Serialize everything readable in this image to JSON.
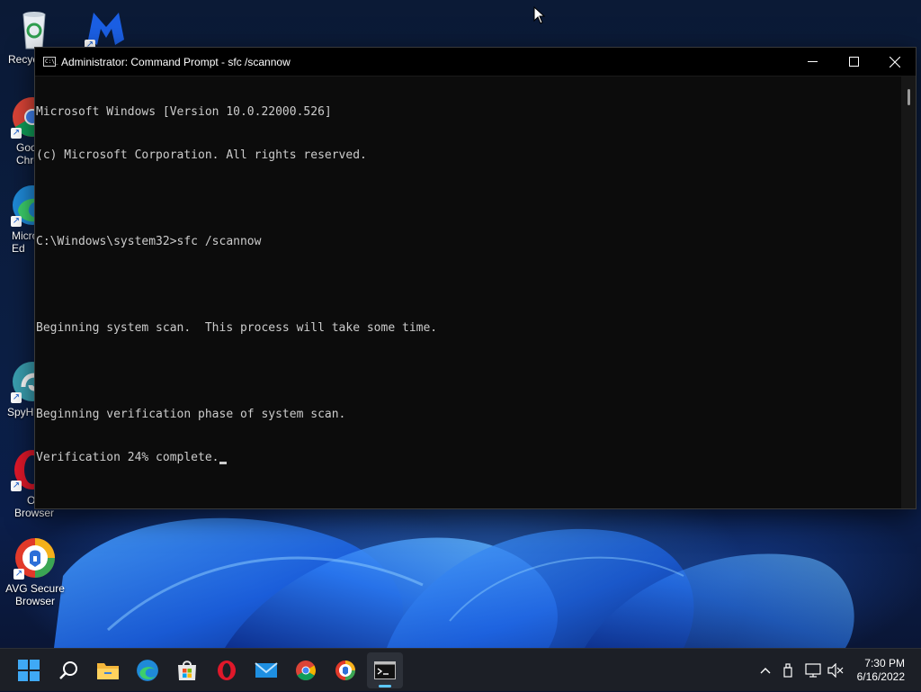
{
  "desktop": {
    "icons": [
      {
        "name": "recycle-bin",
        "label": "Recyc"
      },
      {
        "name": "malwarebytes",
        "label": ""
      },
      {
        "name": "google-chrome",
        "label": "Goo\nChro"
      },
      {
        "name": "microsoft-edge",
        "label": "Micro\nEd"
      },
      {
        "name": "spyhunter",
        "label": "SpyHu"
      },
      {
        "name": "opera-browser",
        "label": "Op\nBrowser"
      },
      {
        "name": "avg-secure-browser",
        "label": "AVG Secure\nBrowser"
      }
    ]
  },
  "window": {
    "title": "Administrator: Command Prompt - sfc  /scannow",
    "icon_text": "C:\\_",
    "controls": [
      "minimize",
      "maximize",
      "close"
    ],
    "console_lines": [
      "Microsoft Windows [Version 10.0.22000.526]",
      "(c) Microsoft Corporation. All rights reserved.",
      "",
      "C:\\Windows\\system32>sfc /scannow",
      "",
      "Beginning system scan.  This process will take some time.",
      "",
      "Beginning verification phase of system scan.",
      "Verification 24% complete."
    ]
  },
  "taskbar": {
    "pinned": [
      "windows-start",
      "search",
      "file-explorer",
      "microsoft-edge",
      "microsoft-store",
      "opera",
      "mail",
      "google-chrome",
      "avg-secure-browser",
      "command-prompt"
    ],
    "active": "command-prompt",
    "tray_icons": [
      "chevron-up",
      "usb-device",
      "network",
      "volume-muted"
    ],
    "time": "7:30 PM",
    "date": "6/16/2022"
  },
  "colors": {
    "console_bg": "#0c0c0c",
    "console_text": "#cccccc",
    "taskbar_bg": "#1c1f26",
    "accent": "#5cc8ff"
  }
}
